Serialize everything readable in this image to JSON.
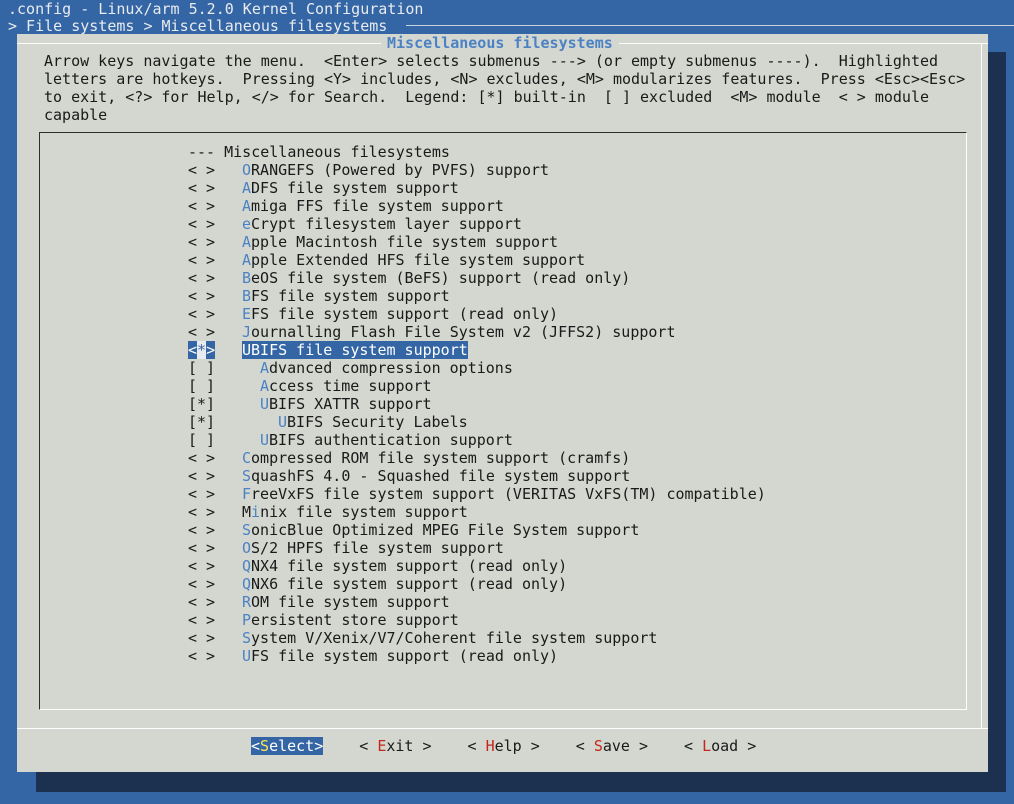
{
  "window": {
    "title": ".config - Linux/arm 5.2.0 Kernel Configuration",
    "breadcrumb": "> File systems > Miscellaneous filesystems"
  },
  "dialog": {
    "title": "Miscellaneous filesystems",
    "help_lines": [
      "Arrow keys navigate the menu.  <Enter> selects submenus ---> (or empty submenus ----).  Highlighted",
      "letters are hotkeys.  Pressing <Y> includes, <N> excludes, <M> modularizes features.  Press <Esc><Esc>",
      "to exit, <?> for Help, </> for Search.  Legend: [*] built-in  [ ] excluded  <M> module  < > module",
      "capable"
    ]
  },
  "menu": {
    "header": "--- Miscellaneous filesystems",
    "items": [
      {
        "sel": "< >",
        "indent": 0,
        "hotkey": "O",
        "rest": "RANGEFS (Powered by PVFS) support"
      },
      {
        "sel": "< >",
        "indent": 0,
        "hotkey": "A",
        "rest": "DFS file system support"
      },
      {
        "sel": "< >",
        "indent": 0,
        "hotkey": "A",
        "rest": "miga FFS file system support"
      },
      {
        "sel": "< >",
        "indent": 0,
        "hotkey": "e",
        "rest": "Crypt filesystem layer support"
      },
      {
        "sel": "< >",
        "indent": 0,
        "hotkey": "A",
        "rest": "pple Macintosh file system support"
      },
      {
        "sel": "< >",
        "indent": 0,
        "hotkey": "A",
        "rest": "pple Extended HFS file system support"
      },
      {
        "sel": "< >",
        "indent": 0,
        "hotkey": "B",
        "rest": "eOS file system (BeFS) support (read only)"
      },
      {
        "sel": "< >",
        "indent": 0,
        "hotkey": "B",
        "rest": "FS file system support"
      },
      {
        "sel": "< >",
        "indent": 0,
        "hotkey": "E",
        "rest": "FS file system support (read only)"
      },
      {
        "sel": "< >",
        "indent": 0,
        "hotkey": "J",
        "rest": "ournalling Flash File System v2 (JFFS2) support"
      },
      {
        "sel": "<*>",
        "indent": 0,
        "hotkey": "U",
        "rest": "BIFS file system support",
        "selected": true
      },
      {
        "sel": "[ ]",
        "indent": 1,
        "hotkey": "A",
        "rest": "dvanced compression options"
      },
      {
        "sel": "[ ]",
        "indent": 1,
        "hotkey": "A",
        "rest": "ccess time support"
      },
      {
        "sel": "[*]",
        "indent": 1,
        "hotkey": "U",
        "rest": "BIFS XATTR support"
      },
      {
        "sel": "[*]",
        "indent": 2,
        "hotkey": "U",
        "rest": "BIFS Security Labels"
      },
      {
        "sel": "[ ]",
        "indent": 1,
        "hotkey": "U",
        "rest": "BIFS authentication support"
      },
      {
        "sel": "< >",
        "indent": 0,
        "hotkey": "C",
        "rest": "ompressed ROM file system support (cramfs)"
      },
      {
        "sel": "< >",
        "indent": 0,
        "hotkey": "S",
        "rest": "quashFS 4.0 - Squashed file system support"
      },
      {
        "sel": "< >",
        "indent": 0,
        "hotkey": "F",
        "rest": "reeVxFS file system support (VERITAS VxFS(TM) compatible)"
      },
      {
        "sel": "< >",
        "indent": 0,
        "pre": "M",
        "hotkey": "i",
        "rest": "nix file system support"
      },
      {
        "sel": "< >",
        "indent": 0,
        "hotkey": "S",
        "rest": "onicBlue Optimized MPEG File System support"
      },
      {
        "sel": "< >",
        "indent": 0,
        "hotkey": "O",
        "rest": "S/2 HPFS file system support"
      },
      {
        "sel": "< >",
        "indent": 0,
        "hotkey": "Q",
        "rest": "NX4 file system support (read only)"
      },
      {
        "sel": "< >",
        "indent": 0,
        "hotkey": "Q",
        "rest": "NX6 file system support (read only)"
      },
      {
        "sel": "< >",
        "indent": 0,
        "hotkey": "R",
        "rest": "OM file system support"
      },
      {
        "sel": "< >",
        "indent": 0,
        "hotkey": "P",
        "rest": "ersistent store support"
      },
      {
        "sel": "< >",
        "indent": 0,
        "hotkey": "S",
        "rest": "ystem V/Xenix/V7/Coherent file system support"
      },
      {
        "sel": "< >",
        "indent": 0,
        "hotkey": "U",
        "rest": "FS file system support (read only)"
      }
    ]
  },
  "buttons": [
    {
      "name": "select-button",
      "left": "<",
      "hotkey": "S",
      "rest": "elect",
      "right": ">",
      "active": true
    },
    {
      "name": "exit-button",
      "left": "< ",
      "hotkey": "E",
      "rest": "xit",
      "right": " >"
    },
    {
      "name": "help-button",
      "left": "< ",
      "hotkey": "H",
      "rest": "elp",
      "right": " >"
    },
    {
      "name": "save-button",
      "left": "< ",
      "hotkey": "S",
      "rest": "ave",
      "right": " >"
    },
    {
      "name": "load-button",
      "left": "< ",
      "hotkey": "L",
      "rest": "oad",
      "right": " >"
    }
  ]
}
